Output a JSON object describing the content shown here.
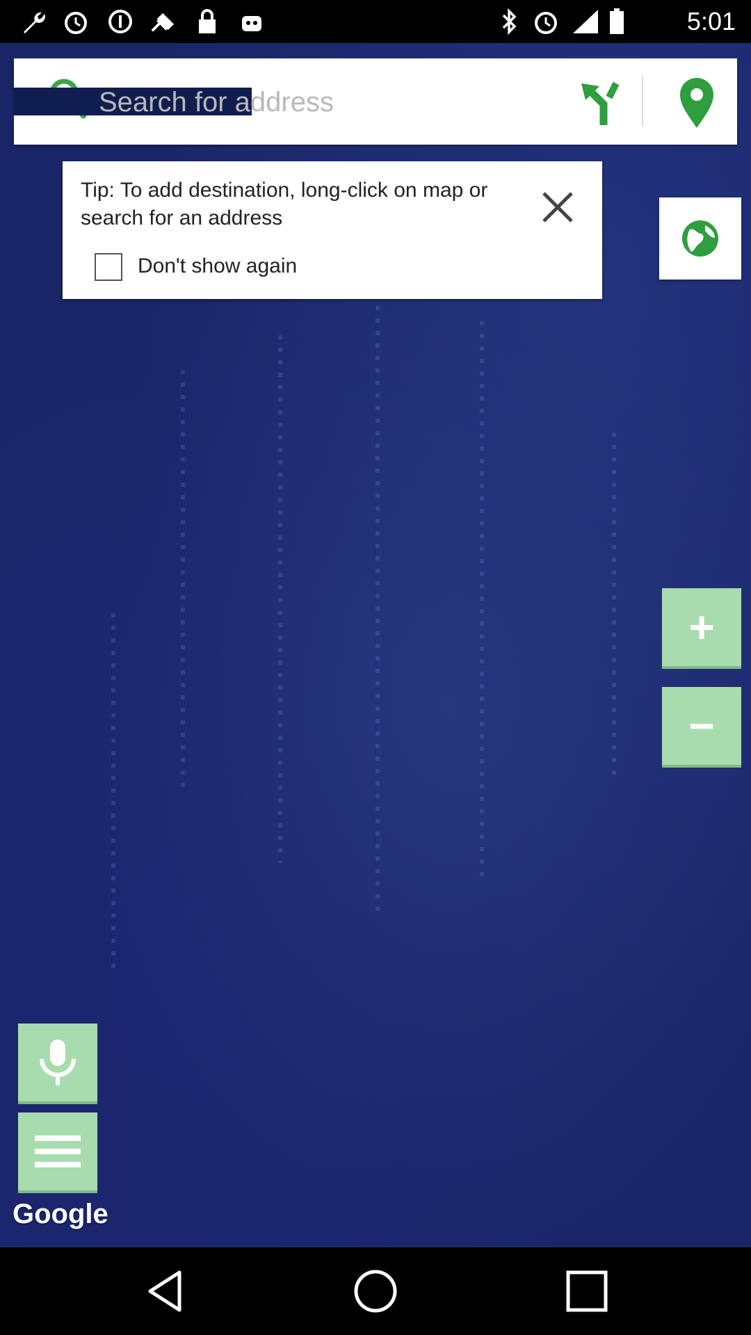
{
  "status_bar": {
    "time": "5:01",
    "icons": [
      "wrench-icon",
      "alarm-icon",
      "info-icon",
      "fake-gps-icon",
      "lock-icon",
      "android-icon",
      "bluetooth-icon",
      "alarm-icon",
      "signal-icon",
      "battery-icon"
    ]
  },
  "search": {
    "placeholder": "Search for address"
  },
  "tip": {
    "text": "Tip: To add destination, long-click on map or search for an address",
    "checkbox_label": "Don't show again",
    "checked": false
  },
  "zoom": {
    "in_label": "+",
    "out_label": "−"
  },
  "map": {
    "attribution": "Google"
  },
  "colors": {
    "accent_green": "#a8dcae",
    "icon_green": "#2e9e3e",
    "ocean_blue": "#1a2568"
  }
}
